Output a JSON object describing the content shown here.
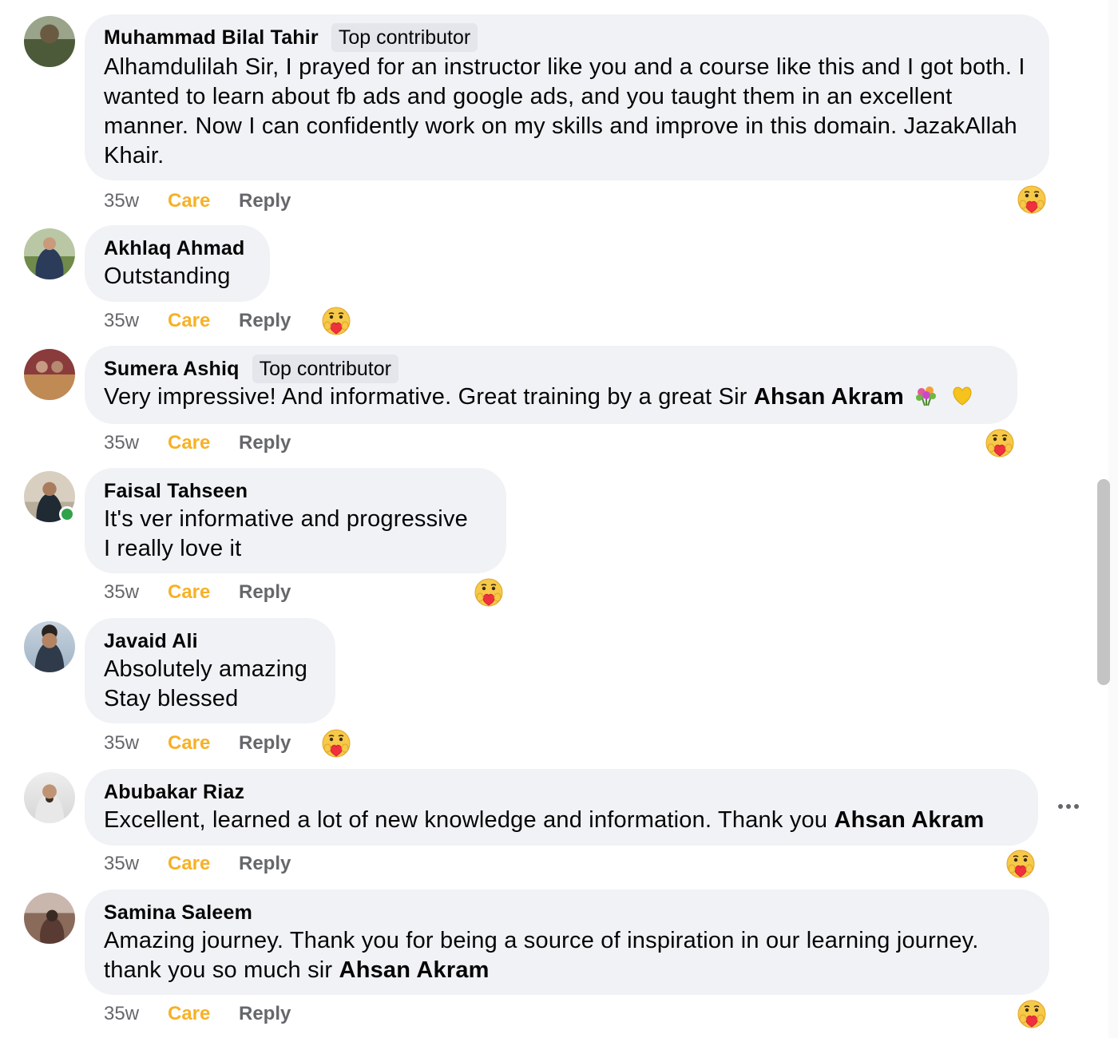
{
  "comments": [
    {
      "name": "Muhammad Bilal Tahir",
      "badge": "Top contributor",
      "text": "Alhamdulilah Sir, I prayed for an instructor like you and a course like this and I got both. I wanted to learn about fb ads and google ads, and you taught them in an excellent manner. Now I can confidently work on my skills and improve in this domain. JazakAllah Khair.",
      "time": "35w",
      "care": "Care",
      "reply": "Reply"
    },
    {
      "name": "Akhlaq Ahmad",
      "text": "Outstanding",
      "time": "35w",
      "care": "Care",
      "reply": "Reply"
    },
    {
      "name": "Sumera Ashiq",
      "badge": "Top contributor",
      "text": "Very impressive! And informative. Great training by a great Sir",
      "mention": "Ahsan Akram",
      "trailing_emojis": [
        "bouquet-emoji",
        "yellow-heart-emoji"
      ],
      "time": "35w",
      "care": "Care",
      "reply": "Reply"
    },
    {
      "name": "Faisal Tahseen",
      "text_line1": "It's ver informative and progressive",
      "text_line2": "I really love it",
      "online": true,
      "time": "35w",
      "care": "Care",
      "reply": "Reply"
    },
    {
      "name": "Javaid Ali",
      "text_line1": "Absolutely amazing",
      "text_line2": "Stay blessed",
      "time": "35w",
      "care": "Care",
      "reply": "Reply"
    },
    {
      "name": "Abubakar Riaz",
      "text": "Excellent, learned a lot of new knowledge and information. Thank you",
      "mention": "Ahsan Akram",
      "time": "35w",
      "care": "Care",
      "reply": "Reply"
    },
    {
      "name": "Samina Saleem",
      "text_line1": "Amazing journey. Thank you for being a source of inspiration in our learning journey.",
      "text_line2_prefix": "thank you so much sir",
      "mention": "Ahsan Akram",
      "time": "35w",
      "care": "Care",
      "reply": "Reply"
    }
  ],
  "reaction_icon": "care-reaction-icon",
  "colors": {
    "bubble": "#f0f2f5",
    "care": "#f7b125",
    "meta": "#65676b",
    "online": "#31a24c"
  }
}
